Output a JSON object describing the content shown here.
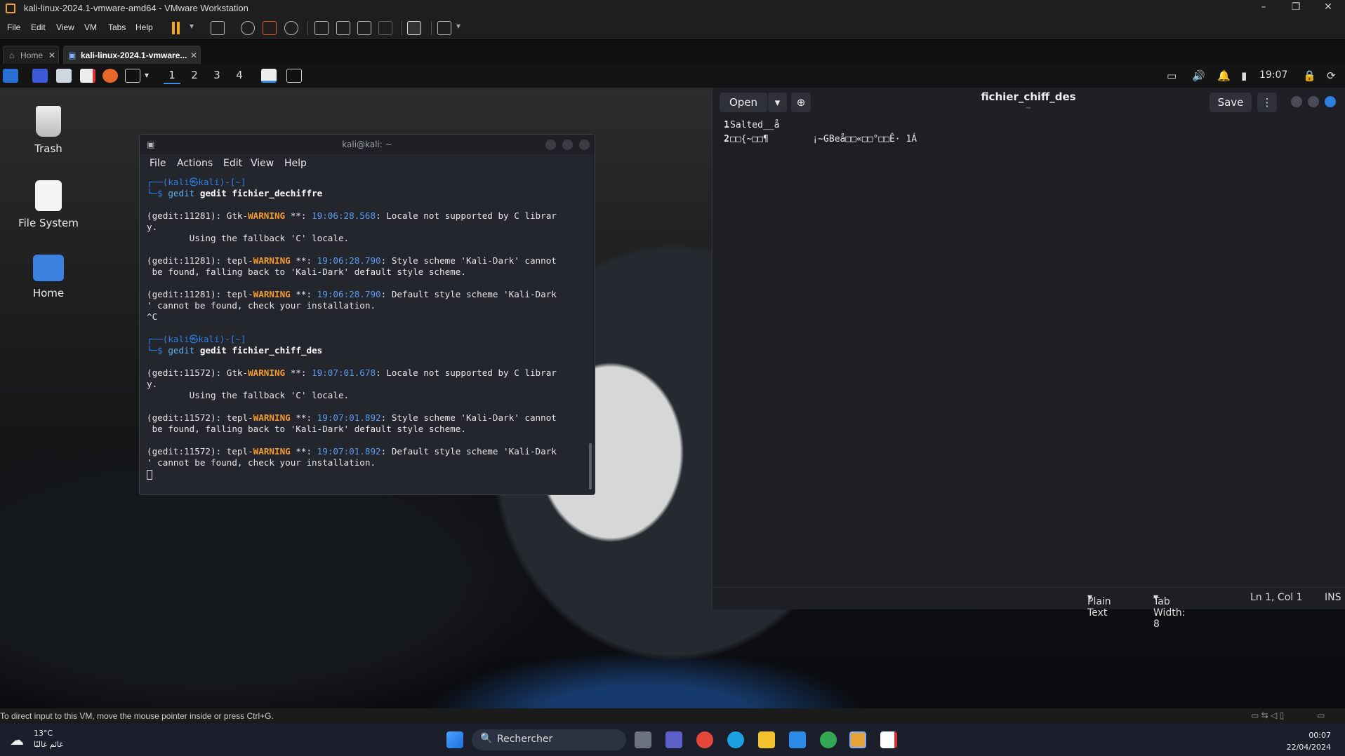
{
  "vmware": {
    "title": "kali-linux-2024.1-vmware-amd64 - VMware Workstation",
    "menu": [
      "File",
      "Edit",
      "View",
      "VM",
      "Tabs",
      "Help"
    ],
    "tabs": [
      {
        "label": "Home"
      },
      {
        "label": "kali-linux-2024.1-vmware..."
      }
    ],
    "status_text": "To direct input to this VM, move the mouse pointer inside or press Ctrl+G."
  },
  "kali_panel": {
    "workspaces": [
      "1",
      "2",
      "3",
      "4"
    ],
    "clock": "19:07"
  },
  "desktop": {
    "icons": [
      {
        "label": "Trash"
      },
      {
        "label": "File System"
      },
      {
        "label": "Home"
      }
    ]
  },
  "terminal": {
    "title": "kali@kali: ~",
    "menu": [
      "File",
      "Actions",
      "Edit",
      "View",
      "Help"
    ],
    "prompt_user": "(kali㉿kali)-[~]",
    "cmd1": "gedit fichier_dechiffre",
    "cmd2": "gedit fichier_chiff_des",
    "lines": {
      "w1a_pre": "(gedit:11281): Gtk-",
      "w1a_ts": "19:06:28.568",
      "w1a_post": ": Locale not supported by C librar",
      "w1b": "y.",
      "w1c": "        Using the fallback 'C' locale.",
      "w2a_pre": "(gedit:11281): tepl-",
      "w2a_ts": "19:06:28.790",
      "w2a_post": ": Style scheme 'Kali-Dark' cannot",
      "w2b": " be found, falling back to 'Kali-Dark' default style scheme.",
      "w3a_pre": "(gedit:11281): tepl-",
      "w3a_ts": "19:06:28.790",
      "w3a_post": ": Default style scheme 'Kali-Dark",
      "w3b": "' cannot be found, check your installation.",
      "ctrlc": "^C",
      "w4a_pre": "(gedit:11572): Gtk-",
      "w4a_ts": "19:07:01.678",
      "w4a_post": ": Locale not supported by C librar",
      "w4b": "y.",
      "w4c": "        Using the fallback 'C' locale.",
      "w5a_pre": "(gedit:11572): tepl-",
      "w5a_ts": "19:07:01.892",
      "w5a_post": ": Style scheme 'Kali-Dark' cannot",
      "w5b": " be found, falling back to 'Kali-Dark' default style scheme.",
      "w6a_pre": "(gedit:11572): tepl-",
      "w6a_ts": "19:07:01.892",
      "w6a_post": ": Default style scheme 'Kali-Dark",
      "w6b": "' cannot be found, check your installation.",
      "warning": "WARNING",
      "stars": " **: "
    }
  },
  "gedit": {
    "open_label": "Open",
    "save_label": "Save",
    "title": "fichier_chiff_des",
    "subtitle": "~",
    "lines": [
      {
        "num": "1",
        "text": "Salted__å"
      },
      {
        "num": "2",
        "text": "□□{~□□¶        ¡~GBeå□□«□□°□□Ê· 1Á"
      }
    ],
    "status": {
      "lang": "Plain Text",
      "tab_width": "Tab Width: 8",
      "position": "Ln 1, Col 1",
      "mode": "INS"
    }
  },
  "taskbar": {
    "weather_temp": "13°C",
    "weather_desc": "غائم غالبًا",
    "search_placeholder": "Rechercher",
    "time": "00:07",
    "date": "22/04/2024"
  }
}
